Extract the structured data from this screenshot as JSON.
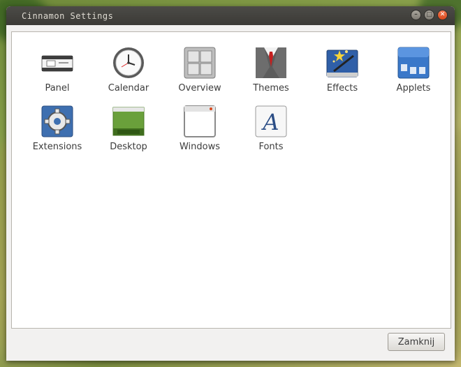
{
  "window": {
    "title": "Cinnamon Settings"
  },
  "items": [
    {
      "label": "Panel",
      "icon": "panel-icon"
    },
    {
      "label": "Calendar",
      "icon": "clock-icon"
    },
    {
      "label": "Overview",
      "icon": "overview-grid-icon"
    },
    {
      "label": "Themes",
      "icon": "suit-tie-icon"
    },
    {
      "label": "Effects",
      "icon": "magic-wand-icon"
    },
    {
      "label": "Applets",
      "icon": "applets-icon"
    },
    {
      "label": "Extensions",
      "icon": "gear-icon"
    },
    {
      "label": "Desktop",
      "icon": "desktop-icon"
    },
    {
      "label": "Windows",
      "icon": "window-icon"
    },
    {
      "label": "Fonts",
      "icon": "font-icon"
    }
  ],
  "footer": {
    "close_label": "Zamknij"
  },
  "colors": {
    "titlebar": "#3b3a36",
    "close_button": "#e0562a",
    "content_bg": "#ffffff"
  }
}
